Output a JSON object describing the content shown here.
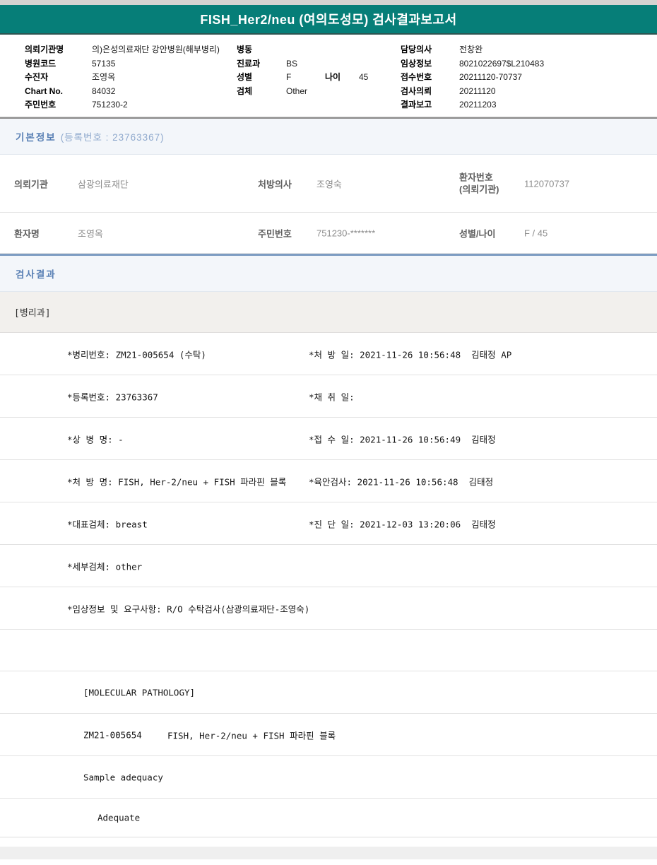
{
  "title": "FISH_Her2/neu (여의도성모) 검사결과보고서",
  "header": {
    "rows": [
      {
        "l1": "의뢰기관명",
        "v1": "의)은성의료재단 강안병원(해부병리)",
        "l2": "병동",
        "v2": "",
        "l3": "",
        "v3": "",
        "l4": "담당의사",
        "v4": "전창완"
      },
      {
        "l1": "병원코드",
        "v1": "57135",
        "l2": "진료과",
        "v2": "BS",
        "l3": "",
        "v3": "",
        "l4": "임상정보",
        "v4": "8021022697$L210483"
      },
      {
        "l1": "수진자",
        "v1": "조영옥",
        "l2": "성별",
        "v2": "F",
        "l3": "나이",
        "v3": "45",
        "l4": "접수번호",
        "v4": "20211120-70737"
      },
      {
        "l1": "Chart No.",
        "v1": "84032",
        "l2": "검체",
        "v2": "Other",
        "l3": "",
        "v3": "",
        "l4": "검사의뢰",
        "v4": "20211120"
      },
      {
        "l1": "주민번호",
        "v1": "751230-2",
        "l2": "",
        "v2": "",
        "l3": "",
        "v3": "",
        "l4": "결과보고",
        "v4": "20211203"
      }
    ]
  },
  "basic_info": {
    "title": "기본정보",
    "subtitle": "(등록번호 : 23763367)",
    "row1": {
      "label1": "의뢰기관",
      "value1": "삼광의료재단",
      "label2": "처방의사",
      "value2": "조영숙",
      "label3_line1": "환자번호",
      "label3_line2": "(의뢰기관)",
      "value3": "112070737"
    },
    "row2": {
      "label1": "환자명",
      "value1": "조영옥",
      "label2": "주민번호",
      "value2": "751230-*******",
      "label3": "성별/나이",
      "value3": "F / 45"
    }
  },
  "results": {
    "title": "검사결과",
    "department": "[병리과]",
    "rows": [
      {
        "left": "*병리번호: ZM21-005654 (수탁)",
        "right": "*처 방 일: 2021-11-26 10:56:48  김태정 AP"
      },
      {
        "left": "*등록번호: 23763367",
        "right": "*채 취 일:"
      },
      {
        "left": "*상 병 명: -",
        "right": "*접 수 일: 2021-11-26 10:56:49  김태정"
      },
      {
        "left": "*처 방 명: FISH, Her-2/neu + FISH 파라핀 블록",
        "right": "*육안검사: 2021-11-26 10:56:48  김태정"
      },
      {
        "left": "*대표검체: breast",
        "right": "*진 단 일: 2021-12-03 13:20:06  김태정"
      },
      {
        "left": "*세부검체: other",
        "right": ""
      },
      {
        "left": "*임상정보 및 요구사항: R/O 수탁검사(삼광의료재단-조영숙)",
        "right": ""
      },
      {
        "left": "",
        "right": ""
      }
    ],
    "molecular": {
      "header": "[MOLECULAR PATHOLOGY]",
      "specimen_id": "ZM21-005654",
      "test_name": "FISH, Her-2/neu + FISH 파라핀 블록",
      "sample_adequacy_label": "Sample adequacy",
      "sample_adequacy_value": "Adequate"
    }
  }
}
